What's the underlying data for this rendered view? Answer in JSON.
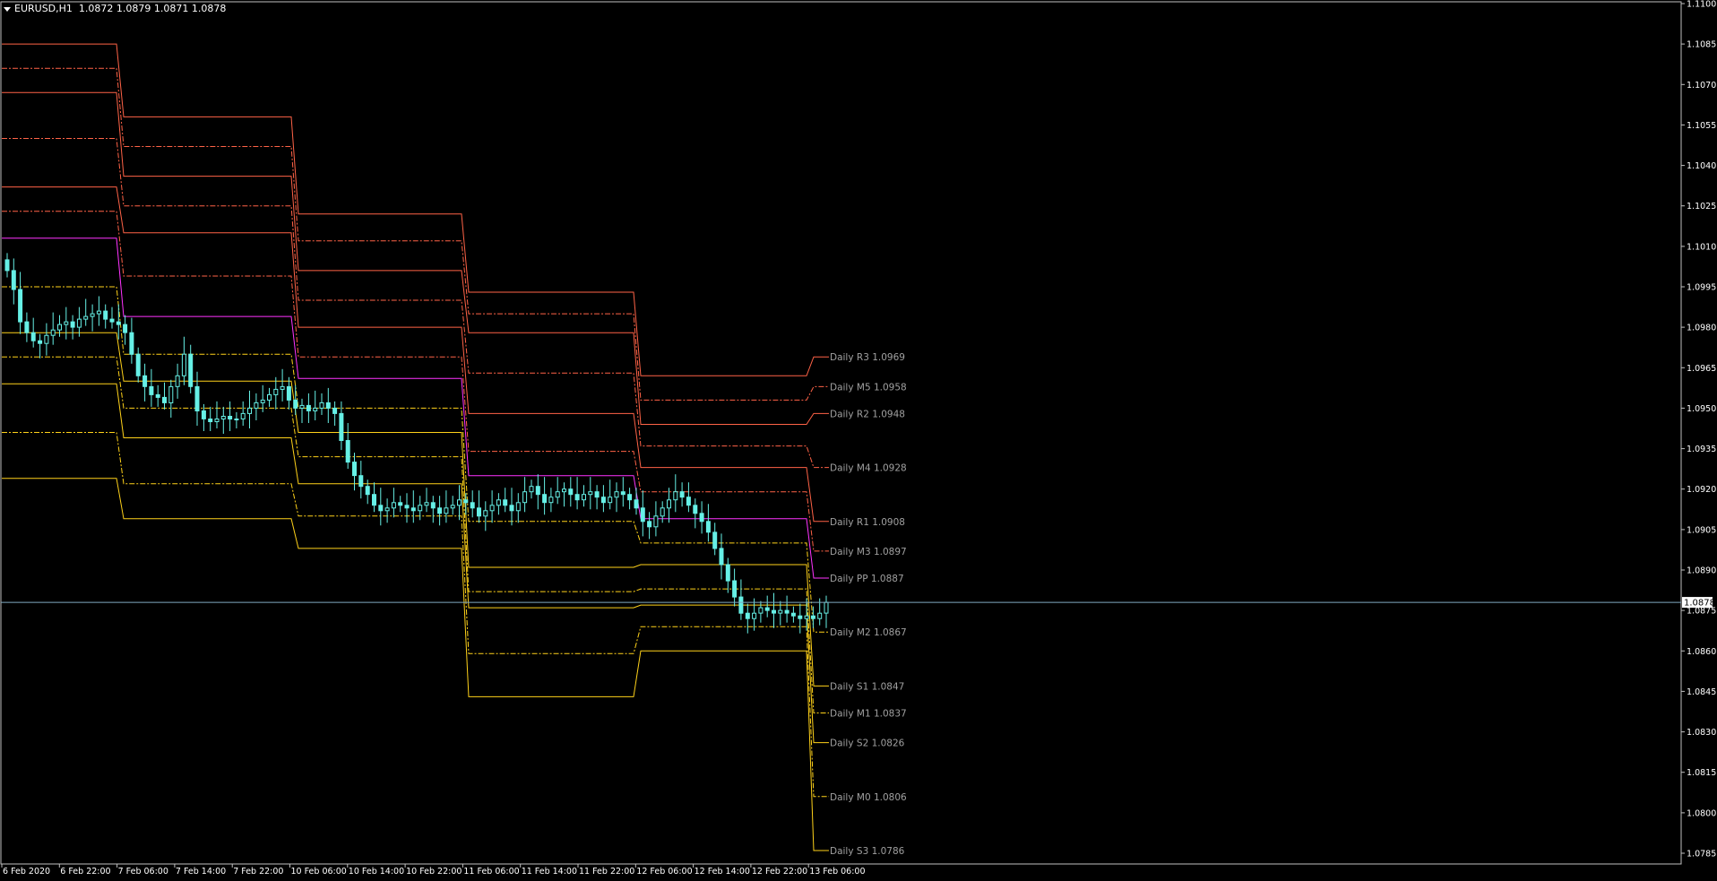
{
  "header": {
    "symbol": "EURUSD,H1",
    "ohlc": "1.0872 1.0879 1.0871 1.0878"
  },
  "colors": {
    "background": "#000000",
    "frame": "#c0c0c0",
    "candle": "#66f0e6",
    "resistance": "#ff6347",
    "pivot": "#ff33ff",
    "support": "#ffd21a",
    "label": "#a0a0a0",
    "priceline": "#7fa9c0"
  },
  "chart_data": {
    "type": "candlestick",
    "title": "EURUSD,H1",
    "ylim": [
      1.0785,
      1.11
    ],
    "current_price": "1.0878",
    "y_ticks": [
      "1.1100",
      "1.1085",
      "1.1070",
      "1.1055",
      "1.1040",
      "1.1025",
      "1.1010",
      "1.0995",
      "1.0980",
      "1.0965",
      "1.0950",
      "1.0935",
      "1.0920",
      "1.0905",
      "1.0890",
      "1.0875",
      "1.0860",
      "1.0845",
      "1.0830",
      "1.0815",
      "1.0800",
      "1.0785"
    ],
    "x_ticks": [
      "6 Feb 2020",
      "6 Feb 22:00",
      "7 Feb 06:00",
      "7 Feb 14:00",
      "7 Feb 22:00",
      "10 Feb 06:00",
      "10 Feb 14:00",
      "10 Feb 22:00",
      "11 Feb 06:00",
      "11 Feb 14:00",
      "11 Feb 22:00",
      "12 Feb 06:00",
      "12 Feb 14:00",
      "12 Feb 22:00",
      "13 Feb 06:00"
    ],
    "days": [
      "6 Feb",
      "7 Feb",
      "10 Feb",
      "11 Feb",
      "12 Feb",
      "13 Feb"
    ],
    "levels": [
      {
        "name": "R3",
        "kind": "resistance",
        "style": "solid",
        "values": [
          1.1085,
          1.1058,
          1.1022,
          1.0993,
          1.0962,
          1.0969
        ]
      },
      {
        "name": "M5",
        "kind": "resistance",
        "style": "dashdot",
        "values": [
          1.1076,
          1.1047,
          1.1012,
          1.0985,
          1.0953,
          1.0958
        ]
      },
      {
        "name": "R2",
        "kind": "resistance",
        "style": "solid",
        "values": [
          1.1067,
          1.1036,
          1.1001,
          1.0978,
          1.0944,
          1.0948
        ]
      },
      {
        "name": "M4",
        "kind": "resistance",
        "style": "dashdot",
        "values": [
          1.105,
          1.1025,
          1.099,
          1.0963,
          1.0936,
          1.0928
        ]
      },
      {
        "name": "R1",
        "kind": "resistance",
        "style": "solid",
        "values": [
          1.1032,
          1.1015,
          1.098,
          1.0948,
          1.0928,
          1.0908
        ]
      },
      {
        "name": "M3",
        "kind": "resistance",
        "style": "dashdot",
        "values": [
          1.1023,
          1.0999,
          1.0969,
          1.0934,
          1.0919,
          1.0897
        ]
      },
      {
        "name": "PP",
        "kind": "pivot",
        "style": "solid",
        "values": [
          1.1013,
          1.0984,
          1.0961,
          1.0925,
          1.0909,
          1.0887
        ]
      },
      {
        "name": "M2",
        "kind": "support",
        "style": "dashdot",
        "values": [
          1.0995,
          1.097,
          1.095,
          1.0908,
          1.09,
          1.0867
        ]
      },
      {
        "name": "S1",
        "kind": "support",
        "style": "solid",
        "values": [
          1.0978,
          1.096,
          1.0941,
          1.0891,
          1.0892,
          1.0847
        ]
      },
      {
        "name": "M1",
        "kind": "support",
        "style": "dashdot",
        "values": [
          1.0969,
          1.095,
          1.0932,
          1.0882,
          1.0883,
          1.0837
        ]
      },
      {
        "name": "S2",
        "kind": "support",
        "style": "solid",
        "values": [
          1.0959,
          1.0939,
          1.0922,
          1.0876,
          1.0877,
          1.0826
        ]
      },
      {
        "name": "M0",
        "kind": "support",
        "style": "dashdot",
        "values": [
          1.0941,
          1.0922,
          1.091,
          1.0859,
          1.0869,
          1.0806
        ]
      },
      {
        "name": "S3",
        "kind": "support",
        "style": "solid",
        "values": [
          1.0924,
          1.0909,
          1.0898,
          1.0843,
          1.086,
          1.0786
        ]
      }
    ],
    "level_labels": [
      {
        "text": "Daily R3 1.0969",
        "price": 1.0969
      },
      {
        "text": "Daily M5 1.0958",
        "price": 1.0958
      },
      {
        "text": "Daily R2 1.0948",
        "price": 1.0948
      },
      {
        "text": "Daily M4 1.0928",
        "price": 1.0928
      },
      {
        "text": "Daily R1 1.0908",
        "price": 1.0908
      },
      {
        "text": "Daily M3 1.0897",
        "price": 1.0897
      },
      {
        "text": "Daily PP 1.0887",
        "price": 1.0887
      },
      {
        "text": "Daily M2 1.0867",
        "price": 1.0867
      },
      {
        "text": "Daily S1 1.0847",
        "price": 1.0847
      },
      {
        "text": "Daily M1 1.0837",
        "price": 1.0837
      },
      {
        "text": "Daily S2 1.0826",
        "price": 1.0826
      },
      {
        "text": "Daily M0 1.0806",
        "price": 1.0806
      },
      {
        "text": "Daily S3 1.0786",
        "price": 1.0786
      }
    ],
    "closes": [
      1.1001,
      1.0994,
      1.0982,
      1.0978,
      1.0975,
      1.0974,
      1.0977,
      1.0979,
      1.0981,
      1.0982,
      1.098,
      1.0983,
      1.0984,
      1.0985,
      1.0986,
      1.0983,
      1.0982,
      1.0981,
      1.0978,
      1.097,
      1.0962,
      1.0958,
      1.0955,
      1.0954,
      1.0952,
      1.0958,
      1.0962,
      1.097,
      1.0958,
      1.0949,
      1.0946,
      1.0945,
      1.0946,
      1.0947,
      1.0946,
      1.0946,
      1.0948,
      1.095,
      1.0952,
      1.0953,
      1.0955,
      1.0957,
      1.0958,
      1.0953,
      1.095,
      1.0951,
      1.0949,
      1.095,
      1.0952,
      1.095,
      1.0948,
      1.0938,
      1.093,
      1.0925,
      1.0921,
      1.0918,
      1.0914,
      1.0912,
      1.0913,
      1.0915,
      1.0914,
      1.0913,
      1.0912,
      1.0914,
      1.0915,
      1.0913,
      1.0911,
      1.0913,
      1.0914,
      1.0916,
      1.0915,
      1.0913,
      1.091,
      1.0912,
      1.0914,
      1.0916,
      1.0914,
      1.0912,
      1.0915,
      1.0919,
      1.0921,
      1.0918,
      1.0915,
      1.0917,
      1.0919,
      1.092,
      1.0918,
      1.0916,
      1.0918,
      1.0919,
      1.0917,
      1.0915,
      1.0917,
      1.0919,
      1.0918,
      1.0916,
      1.0913,
      1.0908,
      1.0906,
      1.091,
      1.0913,
      1.0916,
      1.0919,
      1.0917,
      1.0914,
      1.0911,
      1.0908,
      1.0904,
      1.0898,
      1.0892,
      1.0886,
      1.088,
      1.0874,
      1.0872,
      1.0874,
      1.0876,
      1.0875,
      1.0874,
      1.0875,
      1.0874,
      1.0873,
      1.0872,
      1.0873,
      1.0872,
      1.0874,
      1.0878
    ]
  }
}
